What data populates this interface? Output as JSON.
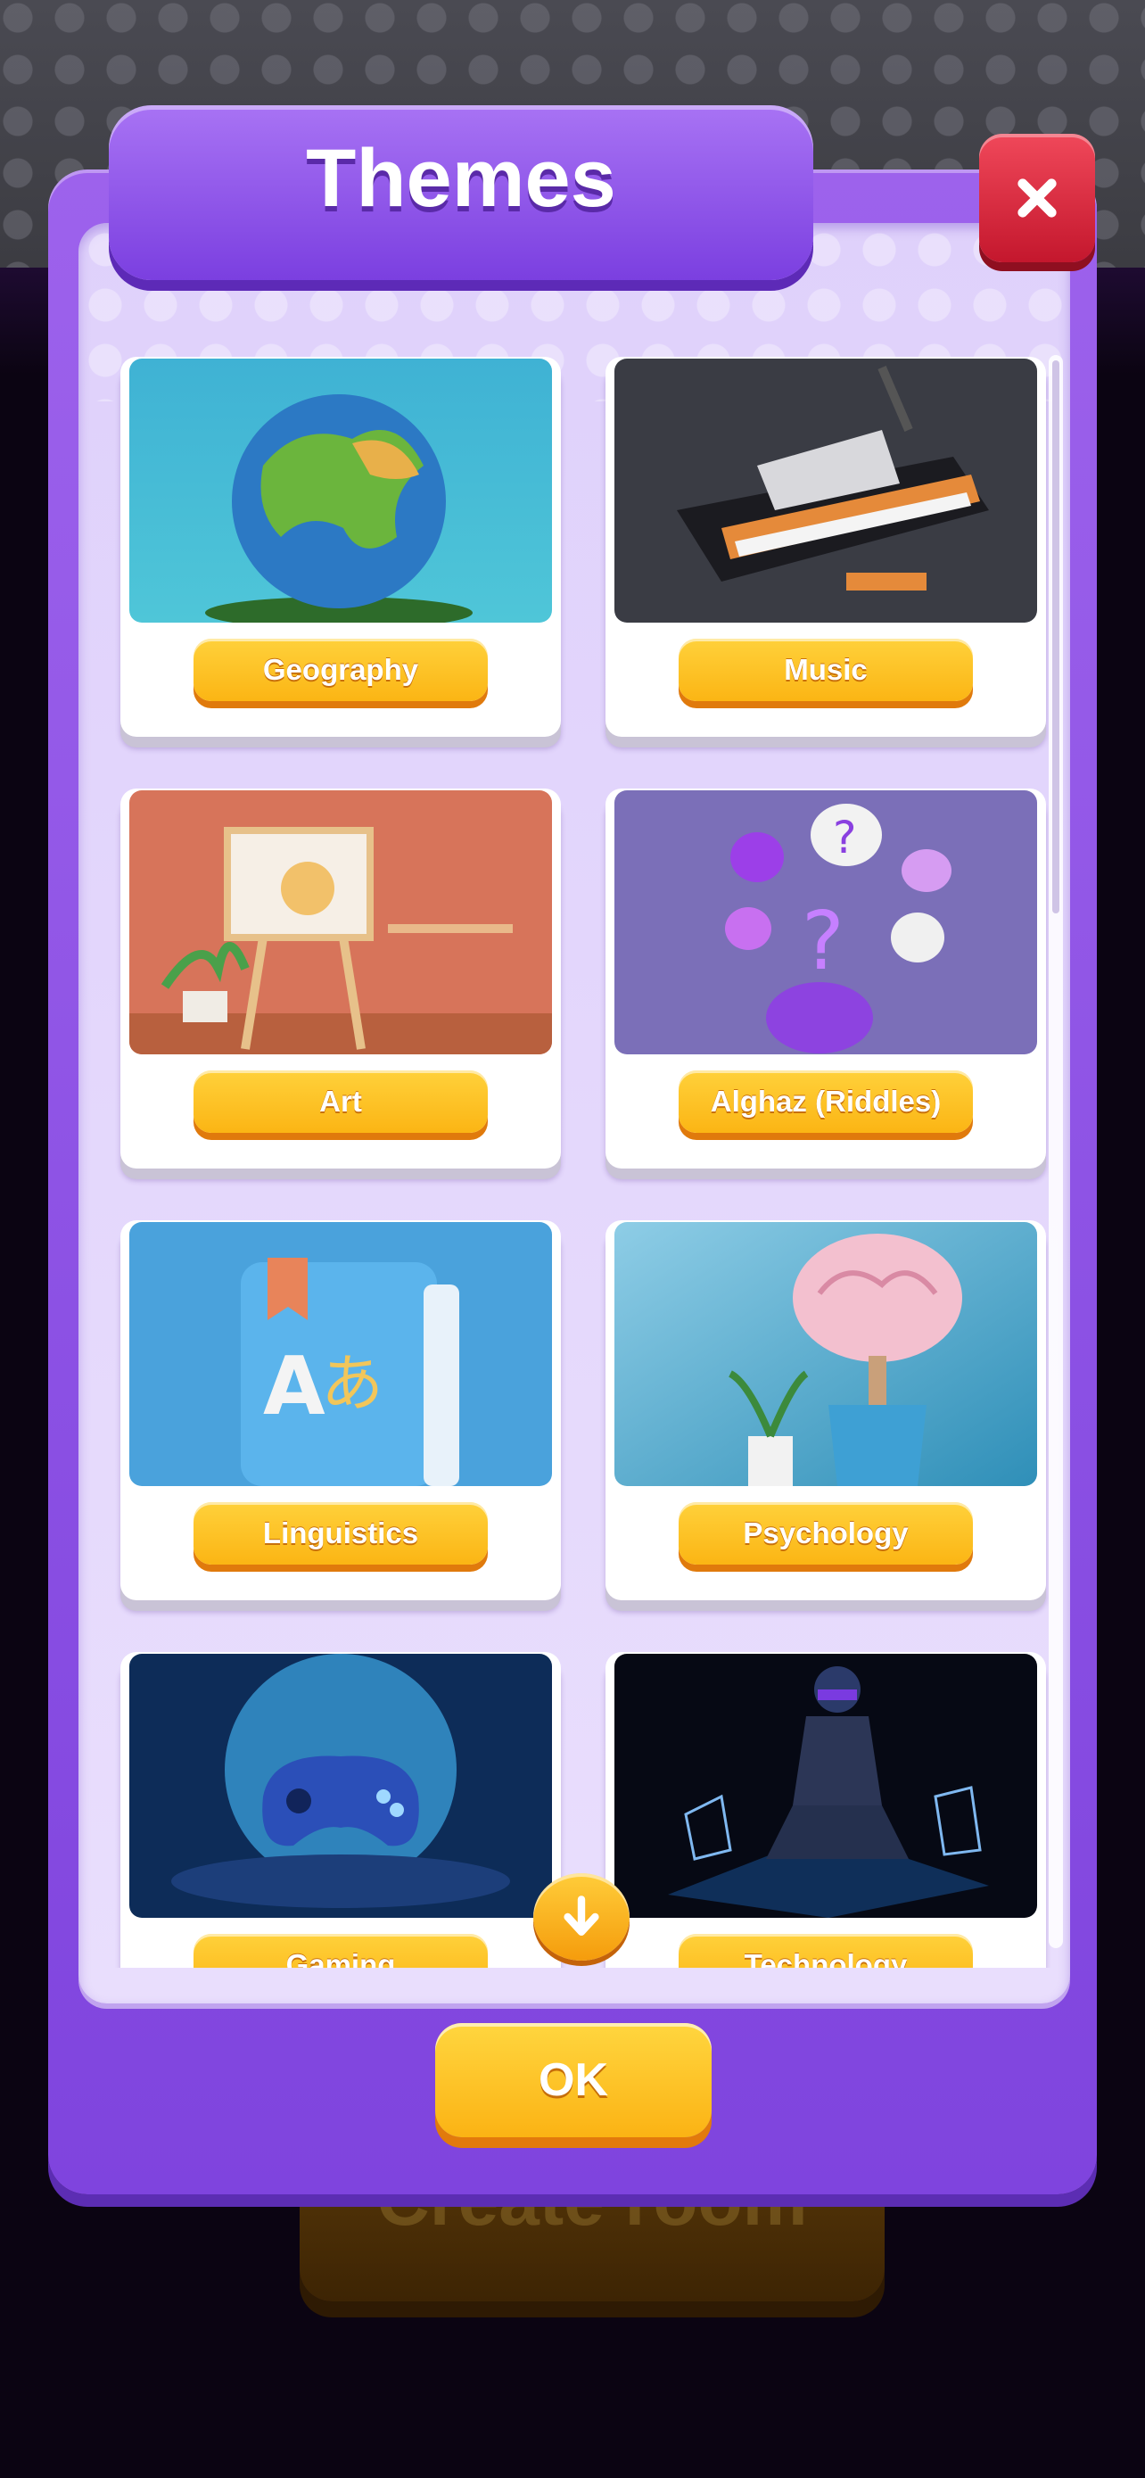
{
  "background": {
    "create_room_label": "Create room"
  },
  "modal": {
    "title": "Themes",
    "ok_label": "OK"
  },
  "themes": [
    {
      "label": "Geography",
      "image": "globe-image"
    },
    {
      "label": "Music",
      "image": "piano-image"
    },
    {
      "label": "Art",
      "image": "easel-image"
    },
    {
      "label": "Alghaz (Riddles)",
      "image": "riddles-image"
    },
    {
      "label": "Linguistics",
      "image": "book-image"
    },
    {
      "label": "Psychology",
      "image": "brain-image"
    },
    {
      "label": "Gaming",
      "image": "gamepad-image"
    },
    {
      "label": "Technology",
      "image": "vr-soldier-image"
    }
  ],
  "colors": {
    "modal_purple": "#8a4fe5",
    "button_yellow": "#fbb514",
    "close_red": "#d9243a"
  }
}
